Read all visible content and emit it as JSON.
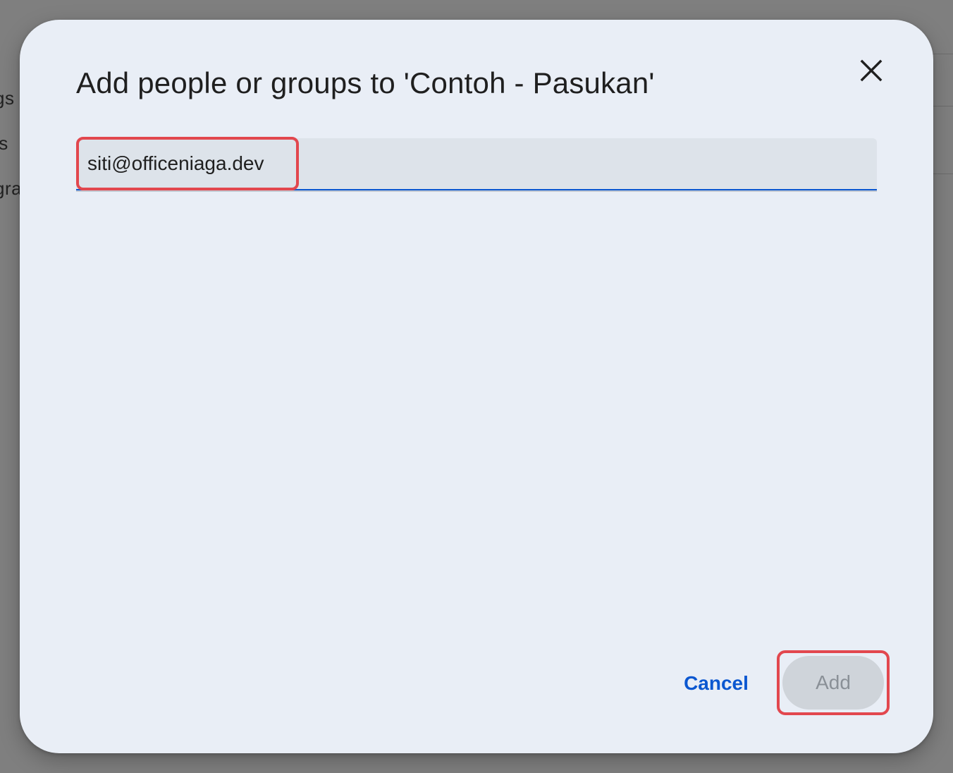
{
  "background": {
    "sidebar_fragments": [
      "gs",
      "ls",
      "gra"
    ]
  },
  "dialog": {
    "title": "Add people or groups to 'Contoh - Pasukan'",
    "close_icon": "close-icon",
    "input": {
      "chip_value": "siti@officeniaga.dev"
    },
    "actions": {
      "cancel_label": "Cancel",
      "add_label": "Add",
      "add_disabled": true
    }
  },
  "colors": {
    "accent": "#0b57d0",
    "dialog_bg": "#e9eef6",
    "highlight": "#e2474e",
    "disabled_button_bg": "#cfd4da",
    "disabled_button_text": "#8a9097"
  }
}
